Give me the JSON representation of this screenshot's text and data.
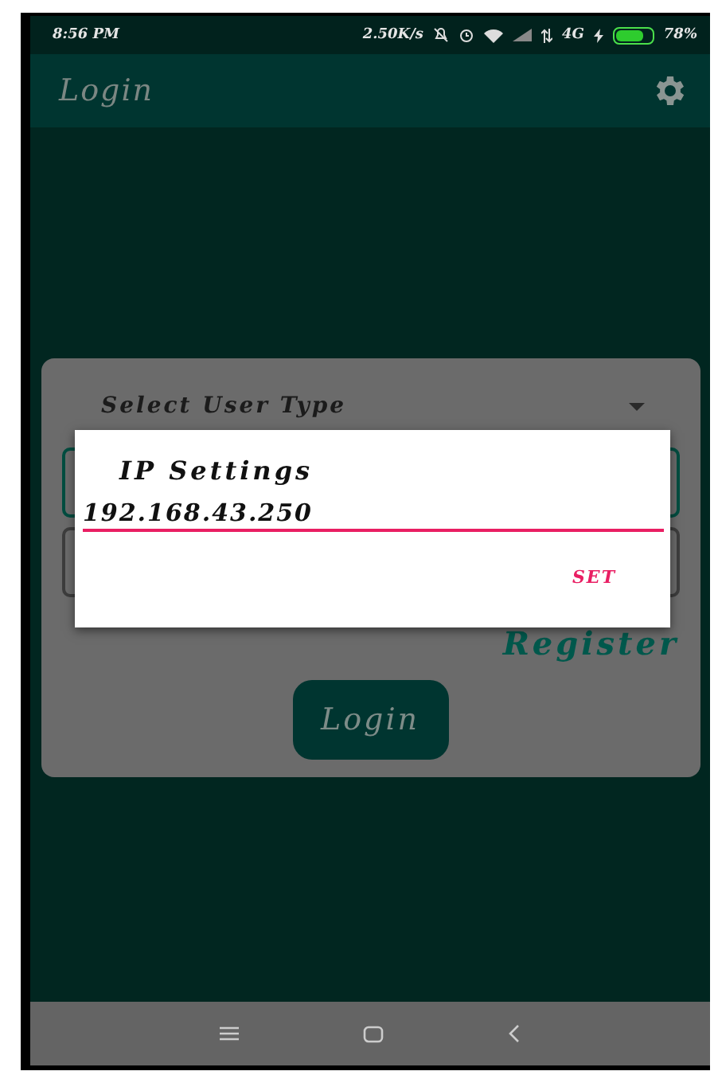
{
  "status_bar": {
    "time": "8:56 PM",
    "speed": "2.50K/s",
    "network": "4G",
    "battery": "78%"
  },
  "app_bar": {
    "title": "Login"
  },
  "login_card": {
    "user_type": {
      "placeholder": "Select User Type"
    },
    "register_link": "Register",
    "login_button": "Login"
  },
  "dialog": {
    "title": "IP Settings",
    "ip_field": {
      "value": "192.168.43.250"
    },
    "set_button": "SET"
  }
}
